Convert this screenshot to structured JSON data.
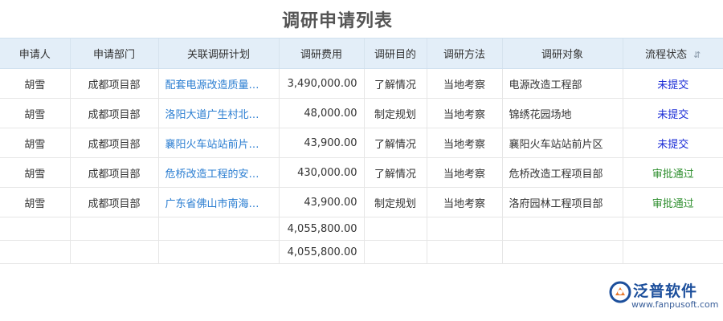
{
  "page": {
    "title": "调研申请列表"
  },
  "table": {
    "headers": [
      "申请人",
      "申请部门",
      "关联调研计划",
      "调研费用",
      "调研目的",
      "调研方法",
      "调研对象",
      "流程状态"
    ],
    "rows": [
      {
        "applicant": "胡雪",
        "dept": "成都项目部",
        "plan": "配套电源改造质量…",
        "cost": "3,490,000.00",
        "purpose": "了解情况",
        "method": "当地考察",
        "target": "电源改造工程部",
        "status": "未提交",
        "status_type": "notsub"
      },
      {
        "applicant": "胡雪",
        "dept": "成都项目部",
        "plan": "洛阳大道广生村北…",
        "cost": "48,000.00",
        "purpose": "制定规划",
        "method": "当地考察",
        "target": "锦绣花园场地",
        "status": "未提交",
        "status_type": "notsub"
      },
      {
        "applicant": "胡雪",
        "dept": "成都项目部",
        "plan": "襄阳火车站站前片…",
        "cost": "43,900.00",
        "purpose": "了解情况",
        "method": "当地考察",
        "target": "襄阳火车站站前片区",
        "status": "未提交",
        "status_type": "notsub"
      },
      {
        "applicant": "胡雪",
        "dept": "成都项目部",
        "plan": "危桥改造工程的安…",
        "cost": "430,000.00",
        "purpose": "了解情况",
        "method": "当地考察",
        "target": "危桥改造工程项目部",
        "status": "审批通过",
        "status_type": "pass"
      },
      {
        "applicant": "胡雪",
        "dept": "成都项目部",
        "plan": "广东省佛山市南海…",
        "cost": "43,900.00",
        "purpose": "制定规划",
        "method": "当地考察",
        "target": "洛府园林工程项目部",
        "status": "审批通过",
        "status_type": "pass"
      }
    ],
    "subtotals": [
      "4,055,800.00",
      "4,055,800.00"
    ]
  },
  "logo": {
    "name": "泛普软件",
    "url": "www.fanpusoft.com",
    "icon": "fanpu-logo-icon"
  },
  "colors": {
    "header_bg": "#e3eef8",
    "link": "#2a7dd1",
    "status_not_submitted": "#1a2bd6",
    "status_approved": "#2f8f2f"
  }
}
